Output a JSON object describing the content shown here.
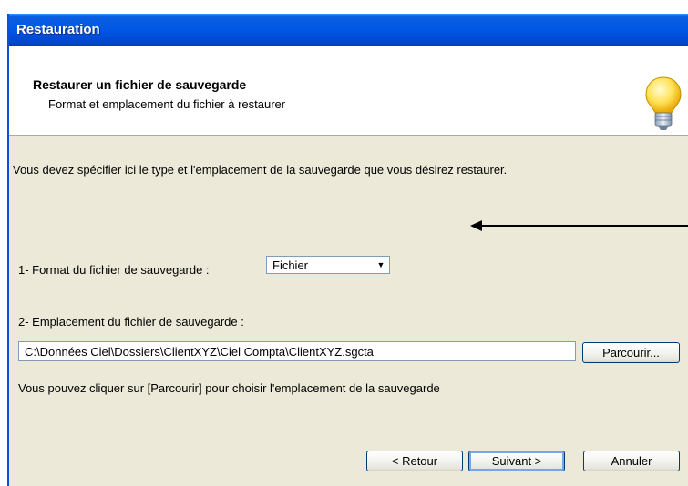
{
  "window": {
    "title": "Restauration"
  },
  "header": {
    "title": "Restaurer un fichier de sauvegarde",
    "subtitle": "Format et emplacement du fichier à restaurer"
  },
  "content": {
    "intro": "Vous devez spécifier ici le type et l'emplacement de la sauvegarde que vous désirez restaurer.",
    "format_label": "1- Format du fichier de sauvegarde :",
    "format_value": "Fichier",
    "location_label": "2- Emplacement du fichier de sauvegarde :",
    "location_value": "C:\\Données Ciel\\Dossiers\\ClientXYZ\\Ciel Compta\\ClientXYZ.sgcta",
    "browse_label": "Parcourir...",
    "hint": "Vous pouvez cliquer sur [Parcourir] pour choisir l'emplacement de la sauvegarde"
  },
  "buttons": {
    "back": "< Retour",
    "next": "Suivant >",
    "cancel": "Annuler"
  },
  "colors": {
    "titlebar": "#0058e6",
    "dialog_bg": "#ece9d8",
    "button_border": "#003c74"
  },
  "icons": {
    "header_icon": "lightbulb-icon",
    "annotation": "arrow-left-icon"
  }
}
